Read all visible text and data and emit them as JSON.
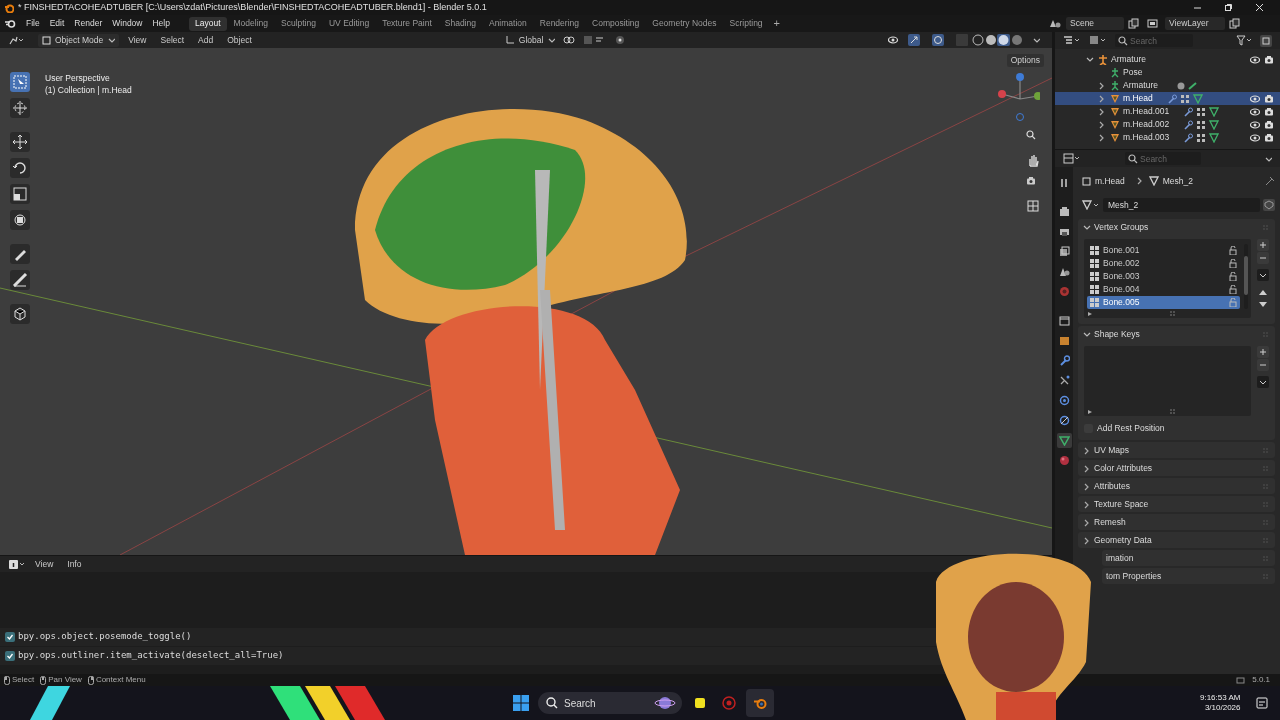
{
  "title_bar": {
    "title": "* FINSHEDTACOHEADTUBER [C:\\Users\\zdat\\Pictures\\Blender\\FINSHEDTACOHEADTUBER.blend1] - Blender 5.0.1"
  },
  "menu": [
    "File",
    "Edit",
    "Render",
    "Window",
    "Help"
  ],
  "workspaces": [
    {
      "label": "Layout",
      "selected": true
    },
    {
      "label": "Modeling",
      "selected": false
    },
    {
      "label": "Sculpting",
      "selected": false
    },
    {
      "label": "UV Editing",
      "selected": false
    },
    {
      "label": "Texture Paint",
      "selected": false
    },
    {
      "label": "Shading",
      "selected": false
    },
    {
      "label": "Animation",
      "selected": false
    },
    {
      "label": "Rendering",
      "selected": false
    },
    {
      "label": "Compositing",
      "selected": false
    },
    {
      "label": "Geometry Nodes",
      "selected": false
    },
    {
      "label": "Scripting",
      "selected": false
    }
  ],
  "add_workspace": "+",
  "scene": "Scene",
  "view_layer": "ViewLayer",
  "viewport": {
    "mode": "Object Mode",
    "menus": [
      "View",
      "Select",
      "Add",
      "Object"
    ],
    "orientation": "Global",
    "overlay_lines": [
      "User Perspective",
      "(1) Collection | m.Head"
    ],
    "options": "Options",
    "tools": [
      {
        "kind": "select",
        "selected": true
      },
      {
        "kind": "cursor",
        "selected": false
      },
      {
        "kind": "move",
        "selected": false
      },
      {
        "kind": "rotate",
        "selected": false
      },
      {
        "kind": "scale",
        "selected": false
      },
      {
        "kind": "transform",
        "selected": false
      },
      {
        "kind": "annotate",
        "selected": false
      },
      {
        "kind": "measure",
        "selected": false
      },
      {
        "kind": "add-cube",
        "selected": false
      }
    ]
  },
  "info": {
    "menus": [
      "View",
      "Info"
    ],
    "log": [
      "bpy.ops.object.posemode_toggle()",
      "bpy.ops.outliner.item_activate(deselect_all=True)"
    ]
  },
  "outliner": {
    "search_placeholder": "Search",
    "tree": [
      {
        "label": "Armature",
        "kind": "armature",
        "selected": false,
        "expanded": true,
        "children": [
          {
            "label": "Pose",
            "kind": "pose",
            "selected": false
          },
          {
            "label": "Armature",
            "kind": "armature-data",
            "selected": false,
            "expanded": false
          },
          {
            "label": "m.Head",
            "kind": "mesh",
            "selected": true,
            "expanded": false
          },
          {
            "label": "m.Head.001",
            "kind": "mesh",
            "selected": false,
            "expanded": false
          },
          {
            "label": "m.Head.002",
            "kind": "mesh",
            "selected": false,
            "expanded": false
          },
          {
            "label": "m.Head.003",
            "kind": "mesh",
            "selected": false,
            "expanded": false
          }
        ]
      }
    ]
  },
  "properties": {
    "search_placeholder": "Search",
    "tabs": [
      {
        "kind": "tool",
        "selected": false
      },
      {
        "kind": "render",
        "selected": false
      },
      {
        "kind": "output",
        "selected": false
      },
      {
        "kind": "view-layer",
        "selected": false
      },
      {
        "kind": "scene",
        "selected": false
      },
      {
        "kind": "world",
        "selected": false
      },
      {
        "kind": "collection",
        "selected": false
      },
      {
        "kind": "object",
        "selected": false
      },
      {
        "kind": "modifiers",
        "selected": false
      },
      {
        "kind": "particles",
        "selected": false
      },
      {
        "kind": "physics",
        "selected": false
      },
      {
        "kind": "constraints",
        "selected": false
      },
      {
        "kind": "data",
        "selected": true
      },
      {
        "kind": "material",
        "selected": false
      }
    ],
    "breadcrumb": [
      "m.Head",
      "Mesh_2"
    ],
    "data_name": "Mesh_2",
    "panels": [
      {
        "label": "Vertex Groups",
        "kind": "vertex-groups",
        "expanded": true,
        "items": [
          {
            "label": "Bone.001",
            "selected": false
          },
          {
            "label": "Bone.002",
            "selected": false
          },
          {
            "label": "Bone.003",
            "selected": false
          },
          {
            "label": "Bone.004",
            "selected": false
          },
          {
            "label": "Bone.005",
            "selected": true
          }
        ]
      },
      {
        "label": "Shape Keys",
        "kind": "shape-keys",
        "expanded": true,
        "add_rest_position": {
          "label": "Add Rest Position",
          "checked": false
        }
      },
      {
        "label": "UV Maps",
        "kind": "plain",
        "expanded": false
      },
      {
        "label": "Color Attributes",
        "kind": "plain",
        "expanded": false
      },
      {
        "label": "Attributes",
        "kind": "plain",
        "expanded": false
      },
      {
        "label": "Texture Space",
        "kind": "plain",
        "expanded": false
      },
      {
        "label": "Remesh",
        "kind": "plain",
        "expanded": false
      },
      {
        "label": "Geometry Data",
        "kind": "plain",
        "expanded": false
      },
      {
        "label": "imation",
        "kind": "covered"
      },
      {
        "label": "tom Properties",
        "kind": "covered"
      }
    ]
  },
  "status_bar": {
    "hints": [
      "Select",
      "Pan View",
      "Context Menu"
    ],
    "version": "5.0.1"
  },
  "taskbar": {
    "search_placeholder": "Search",
    "time": "9:16:53 AM",
    "date": "3/10/2026"
  }
}
